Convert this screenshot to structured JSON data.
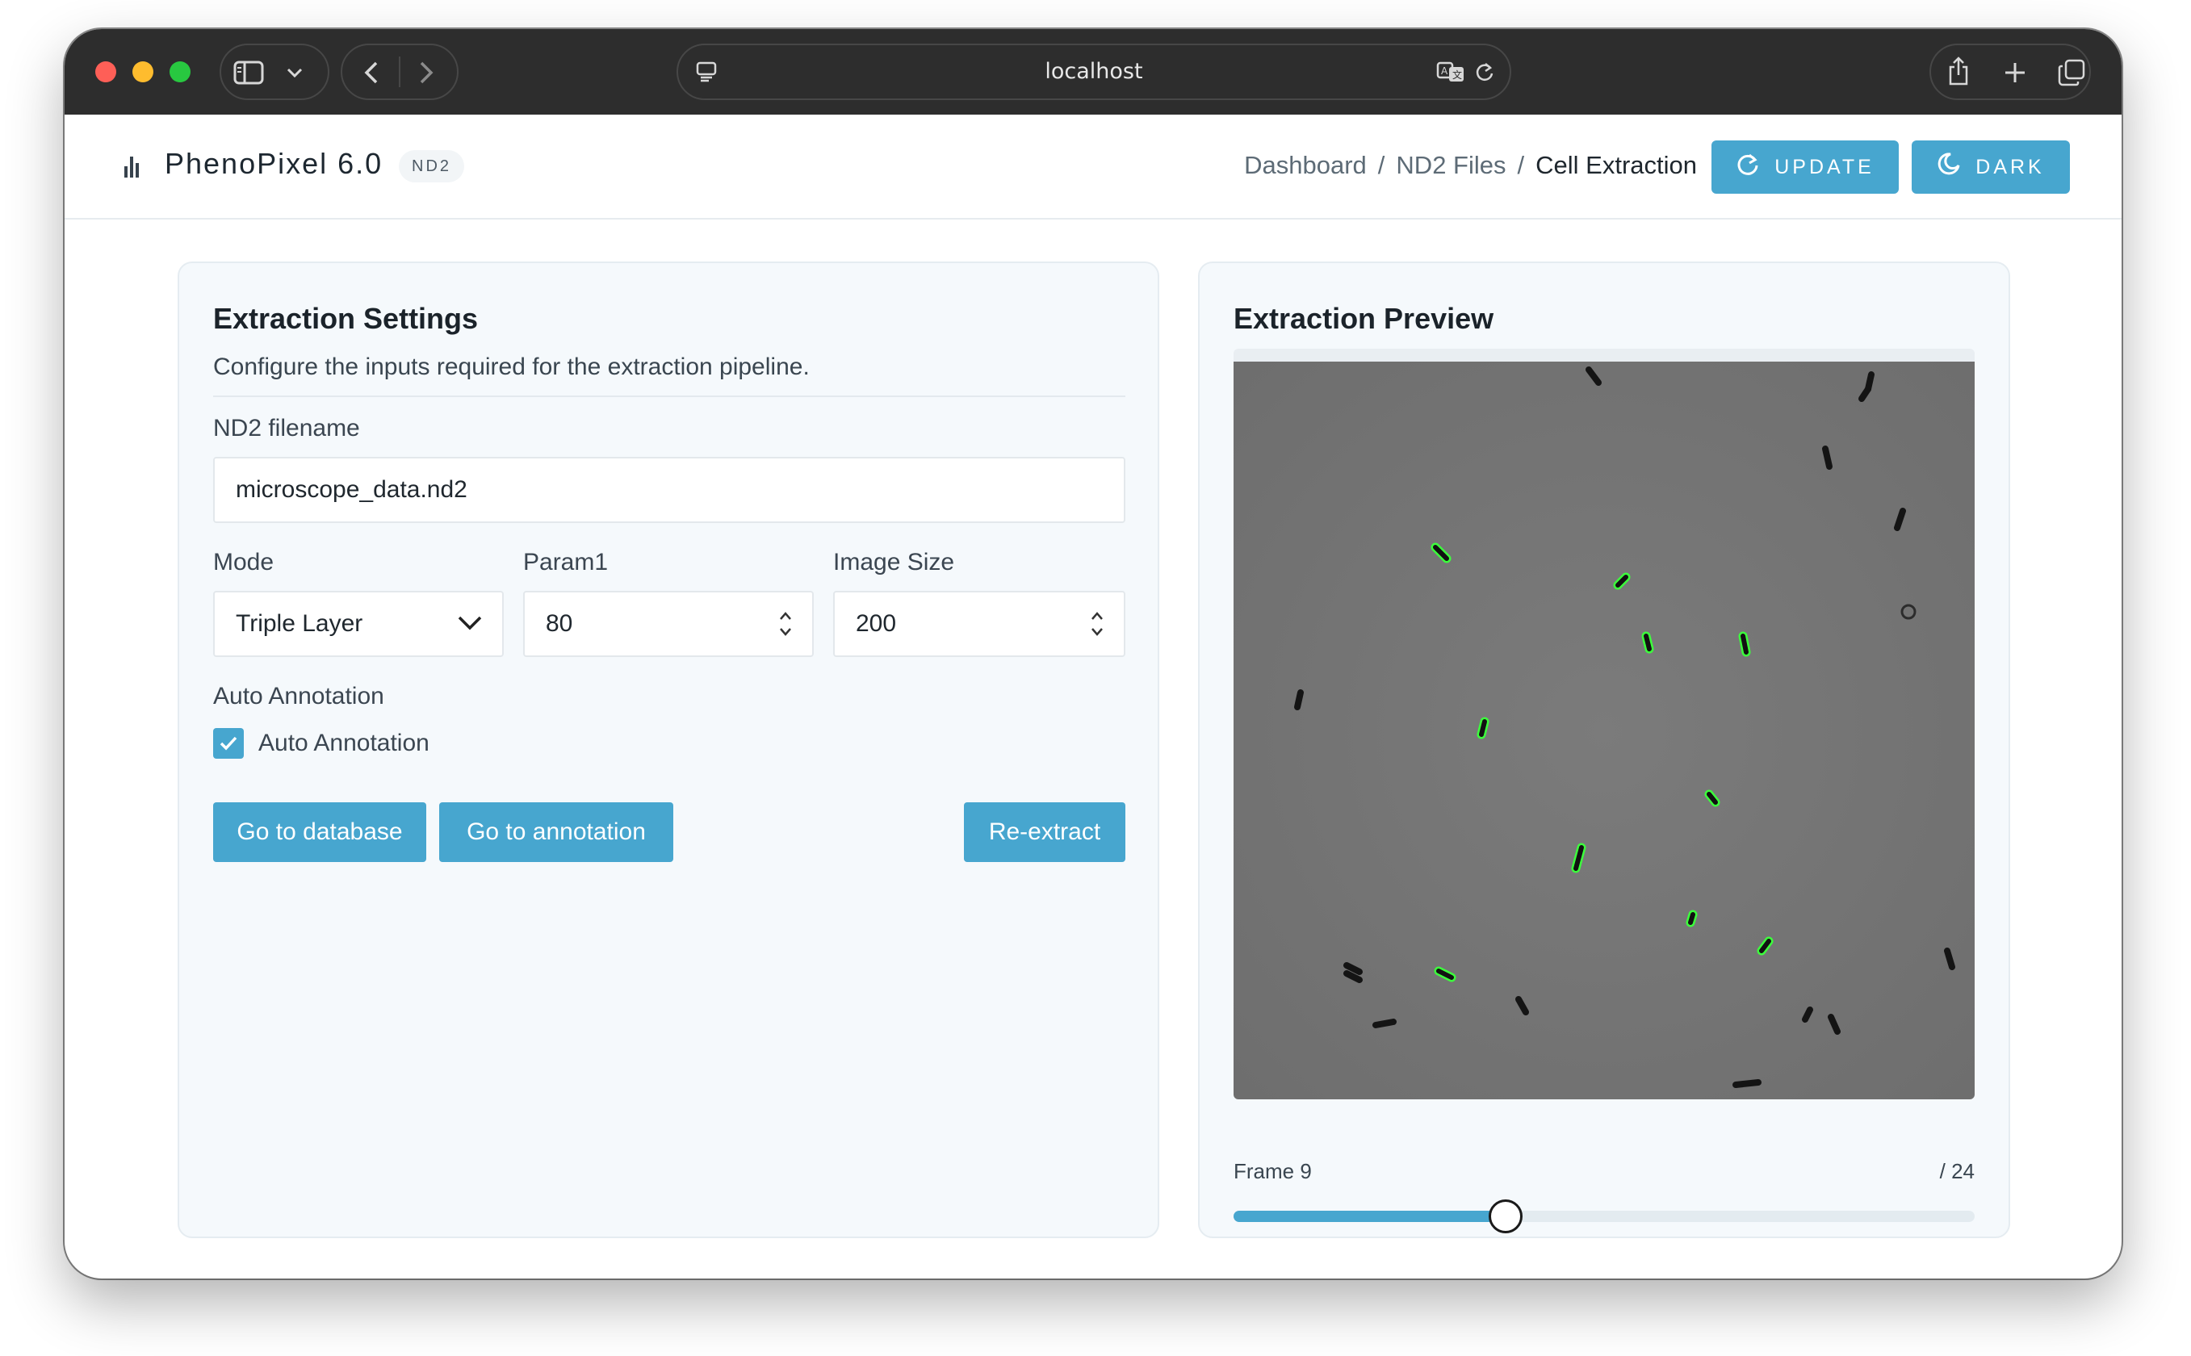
{
  "browser": {
    "address": "localhost",
    "icons": [
      "sidebar-icon",
      "chevron-down-icon",
      "back-icon",
      "forward-icon",
      "reader-icon",
      "translate-icon",
      "reload-icon",
      "share-icon",
      "new-tab-icon",
      "tabs-overview-icon"
    ]
  },
  "header": {
    "brand": "PhenoPixel 6.0",
    "badge": "ND2",
    "breadcrumbs": [
      "Dashboard",
      "ND2 Files",
      "Cell Extraction"
    ],
    "breadcrumb_separator": "/",
    "update_label": "UPDATE",
    "dark_label": "DARK",
    "accent_color": "#47a6cf"
  },
  "settings": {
    "title": "Extraction Settings",
    "description": "Configure the inputs required for the extraction pipeline.",
    "filename_label": "ND2 filename",
    "filename_value": "microscope_data.nd2",
    "mode_label": "Mode",
    "mode_value": "Triple Layer",
    "param1_label": "Param1",
    "param1_value": "80",
    "image_size_label": "Image Size",
    "image_size_value": "200",
    "auto_annotation_heading": "Auto Annotation",
    "auto_annotation_checkbox_label": "Auto Annotation",
    "auto_annotation_checked": true,
    "go_to_database_label": "Go to database",
    "go_to_annotation_label": "Go to annotation",
    "re_extract_label": "Re-extract"
  },
  "preview": {
    "title": "Extraction Preview",
    "frame_label": "Frame 9",
    "frame_total": "/ 24",
    "frame_current": 9,
    "frame_count": 24
  }
}
